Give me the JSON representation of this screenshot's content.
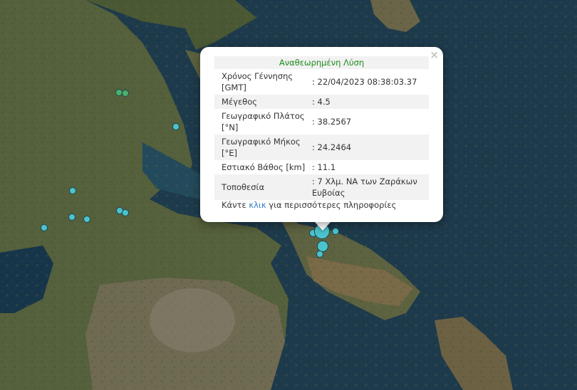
{
  "popup": {
    "title": "Αναθεωρημένη Λύση",
    "close_icon": "×",
    "rows": [
      {
        "label": "Χρόνος Γέννησης [GMT]",
        "value": ": 22/04/2023 08:38:03.37"
      },
      {
        "label": "Μέγεθος",
        "value": ": 4.5"
      },
      {
        "label": "Γεωγραφικό Πλάτος [°N]",
        "value": ": 38.2567"
      },
      {
        "label": "Γεωγραφικό Μήκος [°E]",
        "value": ": 24.2464"
      },
      {
        "label": "Εστιακό Βάθος [km]",
        "value": ": 11.1"
      },
      {
        "label": "Τοποθεσία",
        "value": ": 7 Χλμ. ΝΑ των Ζαράκων Ευβοίας"
      }
    ],
    "more_prefix": "Κάντε",
    "more_link": "κλικ",
    "more_suffix": "για περισσότερες πληροφορίες"
  },
  "colors": {
    "sea": "#1d3a4c",
    "land": "#4e5a3a",
    "marker_cyan": "#4cc3cd",
    "marker_green": "#4caf6a",
    "title_green": "#1a8a1a",
    "link_blue": "#2f78c4"
  }
}
